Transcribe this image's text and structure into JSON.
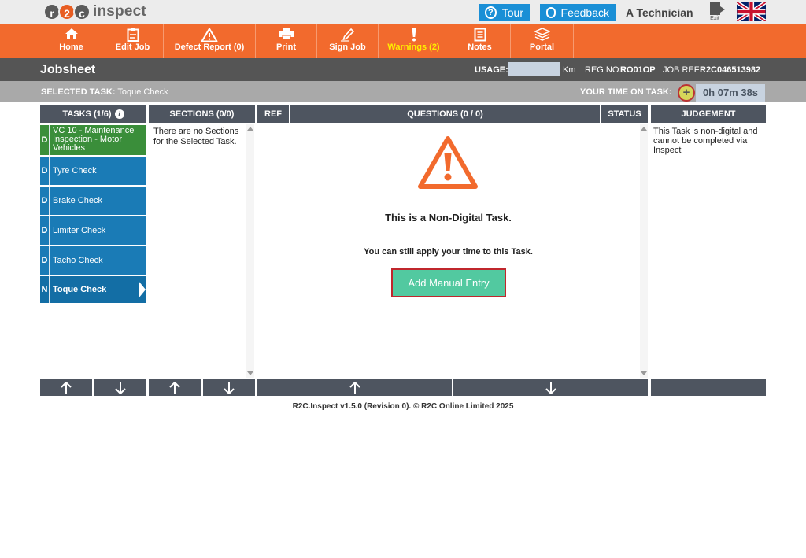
{
  "brand": {
    "logo_letters": [
      "r",
      "2",
      "c"
    ],
    "logo_text": "inspect"
  },
  "topbar": {
    "tour_label": "Tour",
    "feedback_label": "Feedback",
    "user_name": "A Technician",
    "exit_label": "Exit"
  },
  "nav": [
    {
      "label": "Home",
      "icon": "home-icon"
    },
    {
      "label": "Edit Job",
      "icon": "clipboard-icon"
    },
    {
      "label": "Defect Report (0)",
      "icon": "warning-triangle-icon"
    },
    {
      "label": "Print",
      "icon": "printer-icon"
    },
    {
      "label": "Sign Job",
      "icon": "pen-icon"
    },
    {
      "label": "Warnings (2)",
      "icon": "exclamation-icon"
    },
    {
      "label": "Notes",
      "icon": "notes-icon"
    },
    {
      "label": "Portal",
      "icon": "layers-icon"
    }
  ],
  "jobsheet": {
    "title": "Jobsheet",
    "usage_label": "USAGE:",
    "usage_value": "",
    "usage_unit": "Km",
    "reg_label": "REG NO:",
    "reg_value": "RO01OP",
    "jobref_label": "JOB REF:",
    "jobref_value": "R2C046513982"
  },
  "selected": {
    "label": "SELECTED TASK:",
    "task": "Toque Check",
    "time_label": "YOUR TIME ON TASK:",
    "time_value": "0h 07m 38s"
  },
  "columns": {
    "tasks": "TASKS (1/6)",
    "sections": "SECTIONS (0/0)",
    "ref": "REF",
    "questions": "QUESTIONS (0 / 0)",
    "status": "STATUS",
    "judgement": "JUDGEMENT"
  },
  "tasks": [
    {
      "code": "D",
      "name": "VC 10 - Maintenance Inspection - Motor Vehicles",
      "state": "complete"
    },
    {
      "code": "D",
      "name": "Tyre Check",
      "state": "pending"
    },
    {
      "code": "D",
      "name": "Brake Check",
      "state": "pending"
    },
    {
      "code": "D",
      "name": "Limiter Check",
      "state": "pending"
    },
    {
      "code": "D",
      "name": "Tacho Check",
      "state": "pending"
    },
    {
      "code": "N",
      "name": "Toque Check",
      "state": "selected"
    }
  ],
  "sections_empty": "There are no Sections for the Selected Task.",
  "nondigital": {
    "title": "This is a Non-Digital Task.",
    "subtitle": "You can still apply your time to this Task.",
    "button": "Add Manual Entry"
  },
  "judgement_text": "This Task is non-digital and cannot be completed via Inspect",
  "footer": "R2C.Inspect v1.5.0 (Revision 0). © R2C Online Limited 2025",
  "colors": {
    "orange": "#f26a2d",
    "blue": "#1a8fd6",
    "task_blue": "#1a7bb6",
    "task_green": "#3a8e3a",
    "header_dark": "#4e5560",
    "button_green": "#52c9a0",
    "warning_yellow": "#ffee00"
  }
}
